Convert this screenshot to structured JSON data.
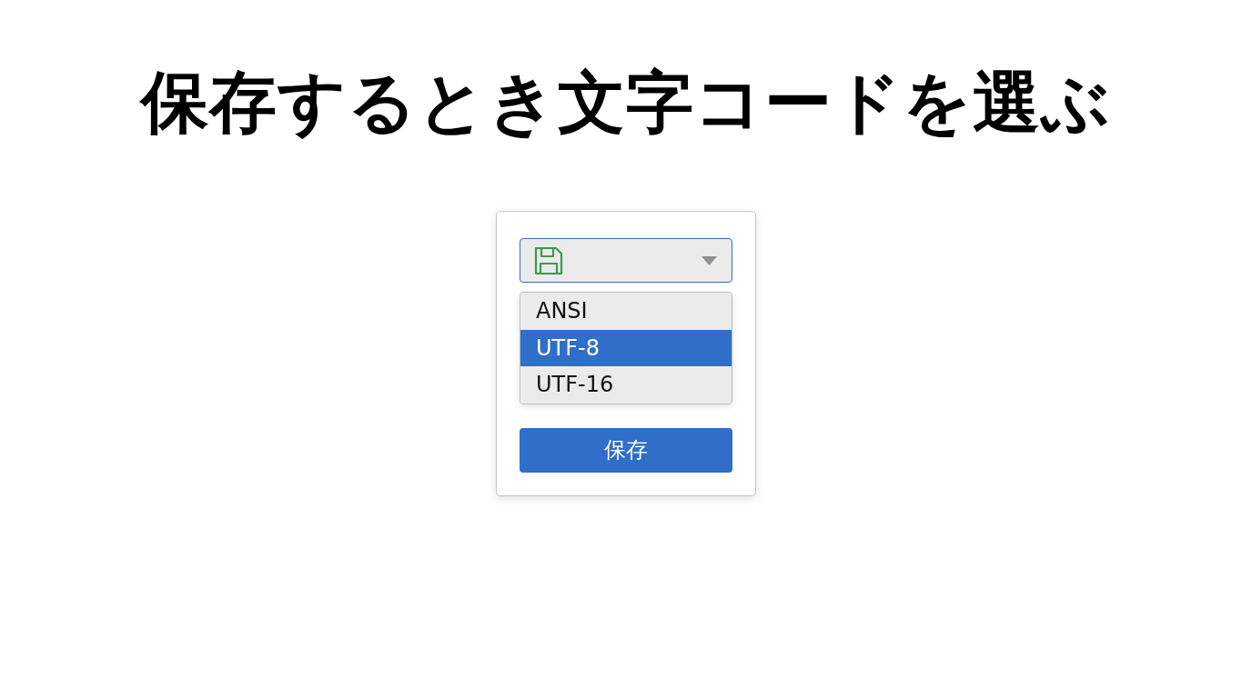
{
  "title": "保存するとき文字コードを選ぶ",
  "encoding_select": {
    "options": [
      {
        "label": "ANSI",
        "selected": false
      },
      {
        "label": "UTF-8",
        "selected": true
      },
      {
        "label": "UTF-16",
        "selected": false
      }
    ]
  },
  "save_button": {
    "label": "保存"
  }
}
